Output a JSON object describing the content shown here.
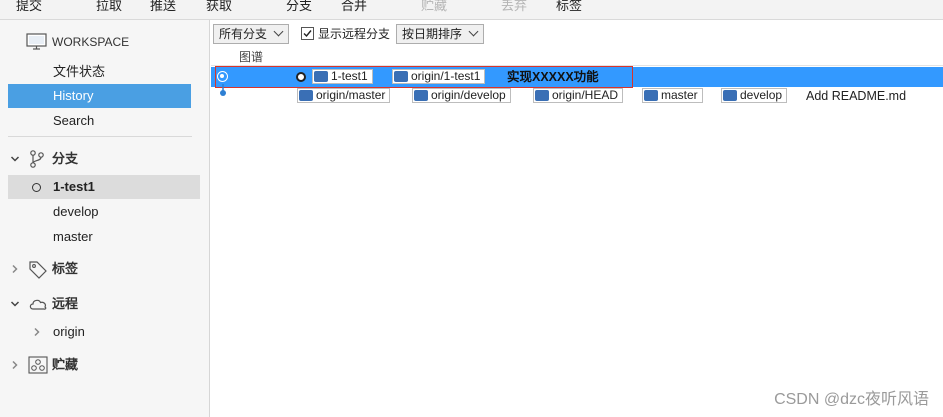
{
  "toolbar": {
    "commit": "提交",
    "pull": "拉取",
    "push": "推送",
    "fetch": "获取",
    "branch": "分支",
    "merge": "合并",
    "stash": "贮藏",
    "discard": "丢弃",
    "tag": "标签"
  },
  "sidebar": {
    "workspace": "WORKSPACE",
    "file_status": "文件状态",
    "history": "History",
    "search": "Search",
    "branches_title": "分支",
    "branches": [
      "1-test1",
      "develop",
      "master"
    ],
    "tags_title": "标签",
    "remotes_title": "远程",
    "remotes": [
      "origin"
    ],
    "stashes_title": "贮藏"
  },
  "filterbar": {
    "branch_filter": "所有分支",
    "show_remote": "显示远程分支",
    "show_remote_checked": true,
    "sort": "按日期排序"
  },
  "columns": {
    "graph": "图谱"
  },
  "commits": [
    {
      "refs": [
        "1-test1",
        "origin/1-test1"
      ],
      "message": "实现XXXXX功能",
      "selected": true
    },
    {
      "refs": [
        "origin/master",
        "origin/develop",
        "origin/HEAD",
        "master",
        "develop"
      ],
      "message": "Add README.md",
      "selected": false
    }
  ],
  "colors": {
    "selection_blue": "#3399ff",
    "sidebar_selected": "#4a9fe3",
    "branch_icon": "#3a6fb5",
    "highlight_outline": "#d9342b",
    "graph_dot": "#2d7fd3"
  },
  "watermark": "CSDN @dzc夜听风语"
}
